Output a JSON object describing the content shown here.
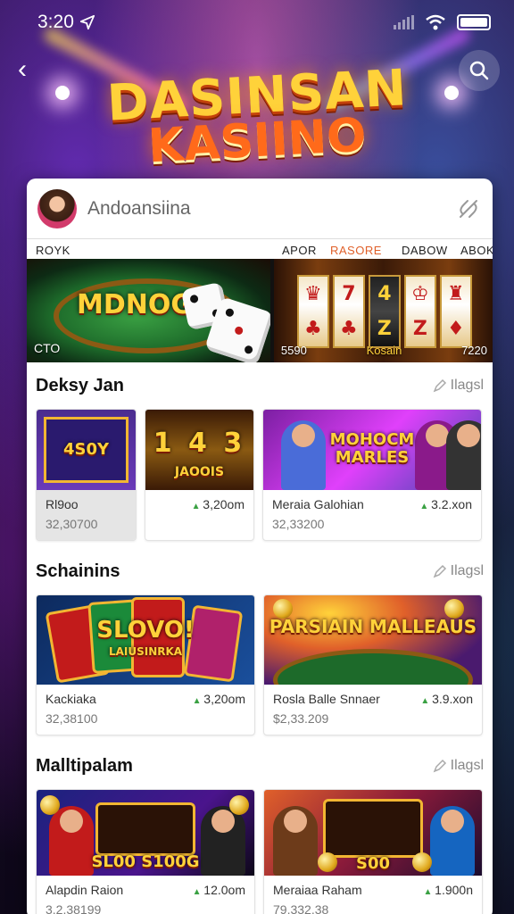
{
  "status_bar": {
    "time": "3:20"
  },
  "header": {
    "title_line1": "DASINSAN",
    "title_line2": "KASIINO"
  },
  "account": {
    "name": "Andoansiina"
  },
  "tabs": [
    "ROYK",
    "APOR",
    "RASORE",
    "DABOW",
    "ABOK"
  ],
  "active_tab": "RASORE",
  "banners": [
    {
      "title": "MDNOGE",
      "caption": "CTO"
    },
    {
      "caption_left": "5590",
      "caption_mid": "Kosain",
      "caption_right": "7220"
    }
  ],
  "sections": [
    {
      "title": "Deksy Jan",
      "more": "Ilagsl",
      "items": [
        {
          "thumb_text": "4S0Y",
          "name": "Rl9oo",
          "sub": "32,30700",
          "price": ""
        },
        {
          "thumb_text": "1 4 3",
          "thumb_sub": "JAOOIS",
          "name": "",
          "sub": "",
          "price": "3,20om"
        },
        {
          "thumb_text": "MOHOCM MARLES",
          "name": "Meraia Galohian",
          "sub": "32,33200",
          "price": "3.2.xon"
        }
      ]
    },
    {
      "title": "Schainins",
      "more": "Ilagsl",
      "items": [
        {
          "thumb_text": "SLOVO!",
          "thumb_sub": "LAIUSINRKA",
          "name": "Kackiaka",
          "sub": "32,38100",
          "price": "3,20om"
        },
        {
          "thumb_text": "PARSIAIN MALLEAUS",
          "name": "Rosla Balle Snnaer",
          "sub": "$2,33.209",
          "price": "3.9.xon"
        }
      ]
    },
    {
      "title": "Malltipalam",
      "more": "Ilagsl",
      "items": [
        {
          "thumb_text": "SL00 S100G",
          "name": "Alapdin Raion",
          "sub": "3.2,38199",
          "price": "12.0om"
        },
        {
          "thumb_text": "S00",
          "name": "Meraiaa Raham",
          "sub": "79,332.38",
          "price": "1.900n"
        }
      ]
    }
  ]
}
